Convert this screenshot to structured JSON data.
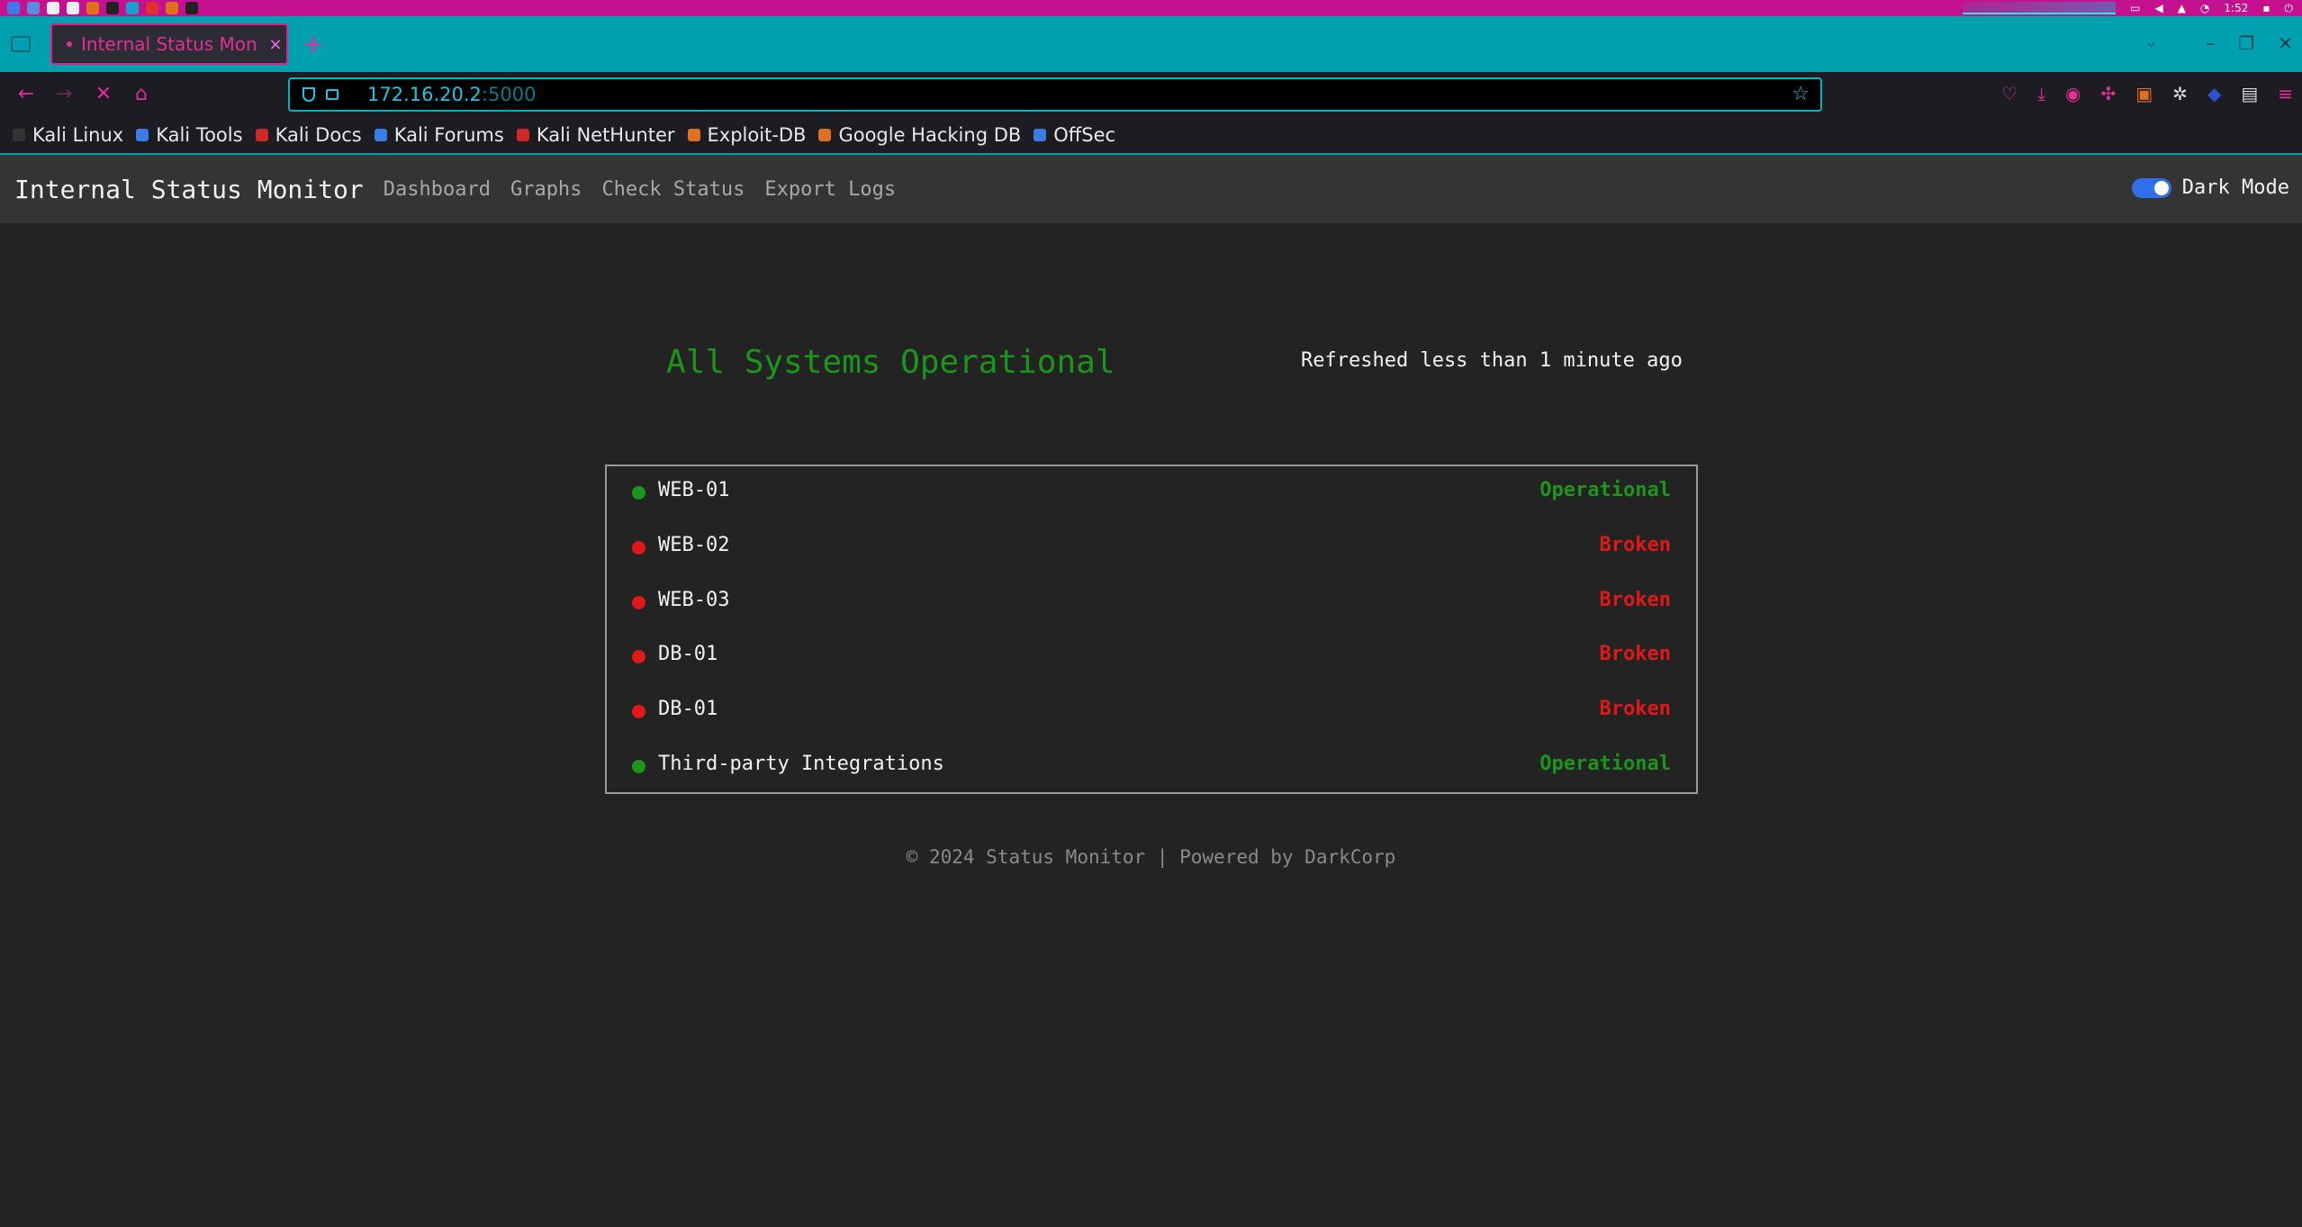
{
  "browser": {
    "tab_title": "Internal Status Mon",
    "tab_close": "×",
    "new_tab": "+",
    "url_host": "172.16.20.2",
    "url_port": ":5000",
    "os_clock": "1:52",
    "accent_color": "#e52e98",
    "chrome_color": "#00a0b0"
  },
  "bookmarks": [
    {
      "label": "Kali Linux",
      "icon": "kali-dragon-icon",
      "color": "#333333"
    },
    {
      "label": "Kali Tools",
      "icon": "kali-tools-icon",
      "color": "#3d7be6"
    },
    {
      "label": "Kali Docs",
      "icon": "kali-docs-icon",
      "color": "#d02828"
    },
    {
      "label": "Kali Forums",
      "icon": "kali-forums-icon",
      "color": "#3d7be6"
    },
    {
      "label": "Kali NetHunter",
      "icon": "nethunter-icon",
      "color": "#d02828"
    },
    {
      "label": "Exploit-DB",
      "icon": "exploit-db-icon",
      "color": "#e07020"
    },
    {
      "label": "Google Hacking DB",
      "icon": "ghdb-icon",
      "color": "#e07020"
    },
    {
      "label": "OffSec",
      "icon": "offsec-icon",
      "color": "#3d7be6"
    }
  ],
  "site": {
    "brand": "Internal Status Monitor",
    "nav": [
      "Dashboard",
      "Graphs",
      "Check Status",
      "Export Logs"
    ],
    "dark_mode_label": "Dark Mode",
    "dark_mode_on": true,
    "summary": "All Systems Operational",
    "refreshed": "Refreshed less than 1 minute ago",
    "footer": "© 2024 Status Monitor | Powered by DarkCorp"
  },
  "colors": {
    "operational": "#1a961a",
    "broken": "#e01818"
  },
  "systems": [
    {
      "name": "WEB-01",
      "status": "Operational",
      "state": "operational"
    },
    {
      "name": "WEB-02",
      "status": "Broken",
      "state": "broken"
    },
    {
      "name": "WEB-03",
      "status": "Broken",
      "state": "broken"
    },
    {
      "name": "DB-01",
      "status": "Broken",
      "state": "broken"
    },
    {
      "name": "DB-01",
      "status": "Broken",
      "state": "broken"
    },
    {
      "name": "Third-party Integrations",
      "status": "Operational",
      "state": "operational"
    }
  ]
}
